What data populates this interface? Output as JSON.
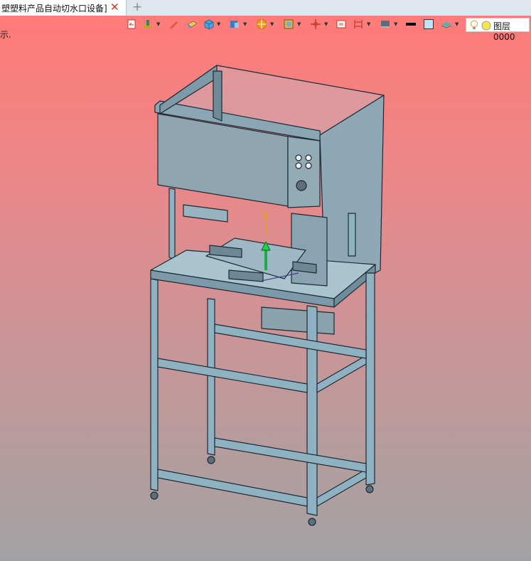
{
  "tab": {
    "title": "塑塑料产品自动切水口设备]",
    "close": "✕",
    "add": "+"
  },
  "hint": "示.",
  "toolbar": {
    "layer_name": "图层0000",
    "icons": [
      "layer-return-icon",
      "pour-icon",
      "pencil-icon",
      "eraser-icon",
      "cube-icon",
      "solid-part-icon",
      "color-wheel-icon",
      "view-fit-icon",
      "move-axis-icon",
      "section-view-icon",
      "dimension-icon",
      "display-mode-icon",
      "line-color-icon",
      "fill-color-icon",
      "layer-stack-icon",
      "lightbulb-icon",
      "layer-status-icon"
    ]
  },
  "model": {
    "axis_label": "Y"
  },
  "colors": {
    "background_top": "#ff7b78",
    "background_bottom": "#a2a2a4",
    "frame": "#8fb2c2",
    "edge": "#1d2a33",
    "panel": "#90a6b3"
  }
}
